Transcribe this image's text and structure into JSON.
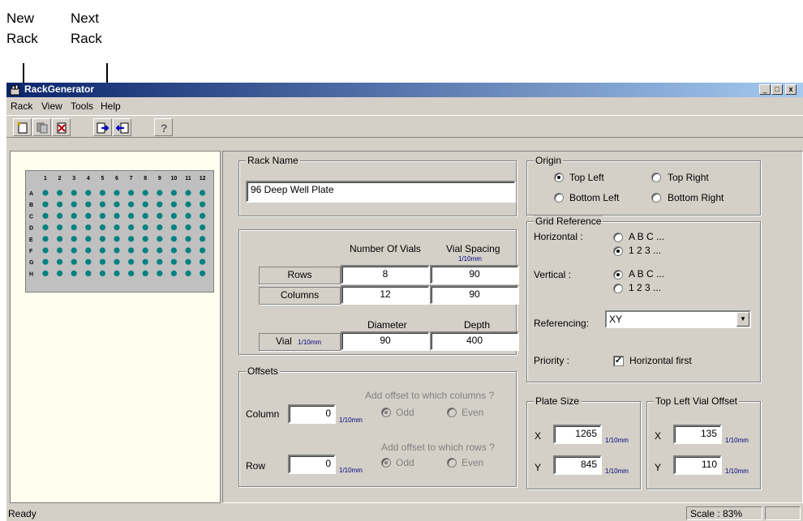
{
  "callouts": {
    "new_rack": [
      "New",
      "Rack"
    ],
    "next_rack": [
      "Next",
      "Rack"
    ]
  },
  "window": {
    "title": "RackGenerator",
    "minimize": "_",
    "maximize": "□",
    "close": "x"
  },
  "menu": [
    "Rack",
    "View",
    "Tools",
    "Help"
  ],
  "toolbar_icons": [
    "new-rack-icon",
    "copy-rack-icon",
    "delete-rack-icon",
    "next-rack-icon",
    "previous-rack-icon",
    "help-icon"
  ],
  "plate": {
    "columns": [
      "1",
      "2",
      "3",
      "4",
      "5",
      "6",
      "7",
      "8",
      "9",
      "10",
      "11",
      "12"
    ],
    "rows": [
      "A",
      "B",
      "C",
      "D",
      "E",
      "F",
      "G",
      "H"
    ],
    "well_color": "#008080"
  },
  "rack_name": {
    "label": "Rack Name",
    "value": "96 Deep Well Plate"
  },
  "vials": {
    "number_header": "Number Of Vials",
    "spacing_header": "Vial Spacing",
    "spacing_unit": "1/10mm",
    "rows_label": "Rows",
    "rows_number": "8",
    "rows_spacing": "90",
    "columns_label": "Columns",
    "columns_number": "12",
    "columns_spacing": "90",
    "diameter_header": "Diameter",
    "depth_header": "Depth",
    "vial_label": "Vial",
    "vial_unit": "1/10mm",
    "diameter": "90",
    "depth": "400"
  },
  "offsets": {
    "label": "Offsets",
    "column_label": "Column",
    "column_value": "0",
    "column_unit": "1/10mm",
    "column_question": "Add offset to which columns ?",
    "row_label": "Row",
    "row_value": "0",
    "row_unit": "1/10mm",
    "row_question": "Add offset to which rows ?",
    "odd": "Odd",
    "even": "Even"
  },
  "origin": {
    "label": "Origin",
    "top_left": "Top Left",
    "top_right": "Top Right",
    "bottom_left": "Bottom Left",
    "bottom_right": "Bottom Right",
    "selected": "Top Left"
  },
  "grid_reference": {
    "label": "Grid Reference",
    "horizontal_label": "Horizontal :",
    "vertical_label": "Vertical :",
    "letters": "A  B  C ...",
    "numbers": "1  2  3 ...",
    "horizontal_selected": "numbers",
    "vertical_selected": "letters",
    "referencing_label": "Referencing:",
    "referencing_value": "XY",
    "priority_label": "Priority :",
    "priority_option": "Horizontal first",
    "priority_checked": true
  },
  "plate_size": {
    "label": "Plate Size",
    "x_label": "X",
    "x_value": "1265",
    "y_label": "Y",
    "y_value": "845",
    "unit": "1/10mm"
  },
  "top_left_offset": {
    "label": "Top Left Vial Offset",
    "x_label": "X",
    "x_value": "135",
    "y_label": "Y",
    "y_value": "110",
    "unit": "1/10mm"
  },
  "status": {
    "text": "Ready",
    "scale": "Scale : 83%"
  }
}
